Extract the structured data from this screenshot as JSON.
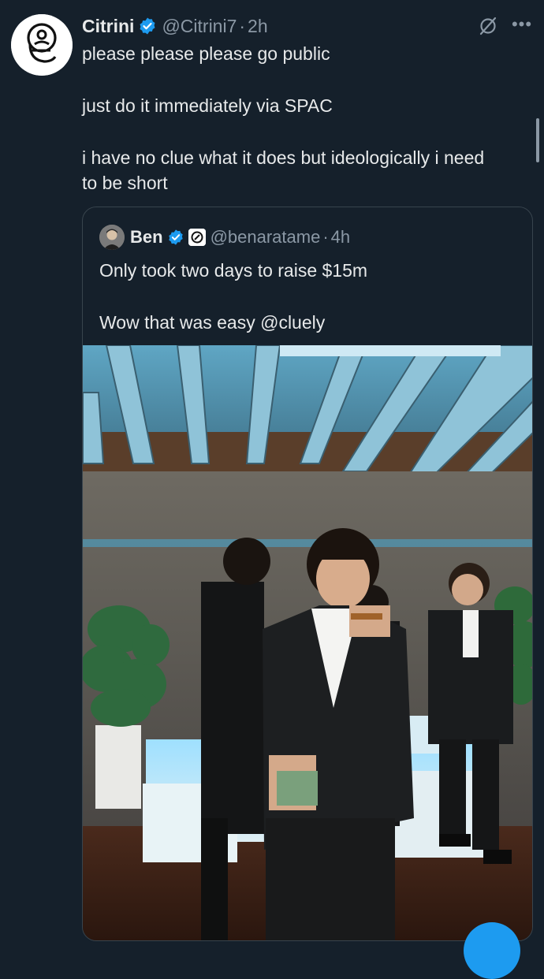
{
  "tweet": {
    "author_name": "Citrini",
    "author_handle": "@Citrini7",
    "separator": "·",
    "time": "2h",
    "lines": [
      "please please please go public",
      "just do it immediately via SPAC",
      "i have no clue what it does but ideologically i need",
      "to be short"
    ]
  },
  "quote": {
    "author_name": "Ben",
    "author_handle": "@benaratame",
    "separator": "·",
    "time": "4h",
    "lines": [
      "Only took two days to raise $15m",
      "Wow that was easy @cluely"
    ]
  },
  "icons": {
    "avatar": "citrini-logo-icon",
    "verified": "verified-badge-icon",
    "grok": "grok-icon",
    "more": "more-icon",
    "affiliation": "affiliate-badge-icon"
  },
  "colors": {
    "background": "#15202b",
    "text": "#e7e9ea",
    "secondary_text": "#8b98a5",
    "accent": "#1d9bf0",
    "border": "#38444d"
  }
}
